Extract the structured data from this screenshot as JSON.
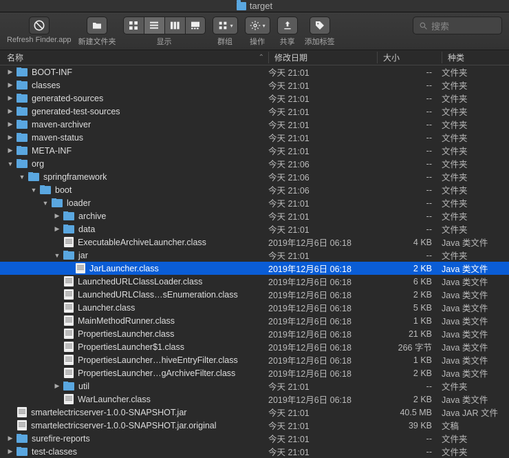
{
  "window": {
    "title": "target"
  },
  "toolbar": {
    "refresh_label": "Refresh Finder.app",
    "new_folder_label": "新建文件夹",
    "view_label": "显示",
    "group_label": "群组",
    "action_label": "操作",
    "share_label": "共享",
    "tags_label": "添加标签",
    "search_placeholder": "搜索"
  },
  "columns": {
    "name": "名称",
    "date": "修改日期",
    "size": "大小",
    "kind": "种类"
  },
  "kinds": {
    "folder": "文件夹",
    "java_class": "Java 类文件",
    "jar": "Java JAR 文件",
    "doc": "文稿"
  },
  "rows": [
    {
      "d": 0,
      "t": "f",
      "e": "c",
      "n": "BOOT-INF",
      "dt": "今天 21:01",
      "s": "--",
      "k": "folder"
    },
    {
      "d": 0,
      "t": "f",
      "e": "c",
      "n": "classes",
      "dt": "今天 21:01",
      "s": "--",
      "k": "folder"
    },
    {
      "d": 0,
      "t": "f",
      "e": "c",
      "n": "generated-sources",
      "dt": "今天 21:01",
      "s": "--",
      "k": "folder"
    },
    {
      "d": 0,
      "t": "f",
      "e": "c",
      "n": "generated-test-sources",
      "dt": "今天 21:01",
      "s": "--",
      "k": "folder"
    },
    {
      "d": 0,
      "t": "f",
      "e": "c",
      "n": "maven-archiver",
      "dt": "今天 21:01",
      "s": "--",
      "k": "folder"
    },
    {
      "d": 0,
      "t": "f",
      "e": "c",
      "n": "maven-status",
      "dt": "今天 21:01",
      "s": "--",
      "k": "folder"
    },
    {
      "d": 0,
      "t": "f",
      "e": "c",
      "n": "META-INF",
      "dt": "今天 21:01",
      "s": "--",
      "k": "folder"
    },
    {
      "d": 0,
      "t": "f",
      "e": "o",
      "n": "org",
      "dt": "今天 21:06",
      "s": "--",
      "k": "folder"
    },
    {
      "d": 1,
      "t": "f",
      "e": "o",
      "n": "springframework",
      "dt": "今天 21:06",
      "s": "--",
      "k": "folder"
    },
    {
      "d": 2,
      "t": "f",
      "e": "o",
      "n": "boot",
      "dt": "今天 21:06",
      "s": "--",
      "k": "folder"
    },
    {
      "d": 3,
      "t": "f",
      "e": "o",
      "n": "loader",
      "dt": "今天 21:01",
      "s": "--",
      "k": "folder"
    },
    {
      "d": 4,
      "t": "f",
      "e": "c",
      "n": "archive",
      "dt": "今天 21:01",
      "s": "--",
      "k": "folder"
    },
    {
      "d": 4,
      "t": "f",
      "e": "c",
      "n": "data",
      "dt": "今天 21:01",
      "s": "--",
      "k": "folder"
    },
    {
      "d": 4,
      "t": "c",
      "n": "ExecutableArchiveLauncher.class",
      "dt": "2019年12月6日 06:18",
      "s": "4 KB",
      "k": "java_class"
    },
    {
      "d": 4,
      "t": "f",
      "e": "o",
      "n": "jar",
      "dt": "今天 21:01",
      "s": "--",
      "k": "folder"
    },
    {
      "d": 5,
      "t": "c",
      "n": "JarLauncher.class",
      "dt": "2019年12月6日 06:18",
      "s": "2 KB",
      "k": "java_class",
      "sel": true
    },
    {
      "d": 4,
      "t": "c",
      "n": "LaunchedURLClassLoader.class",
      "dt": "2019年12月6日 06:18",
      "s": "6 KB",
      "k": "java_class"
    },
    {
      "d": 4,
      "t": "c",
      "n": "LaunchedURLClass…sEnumeration.class",
      "dt": "2019年12月6日 06:18",
      "s": "2 KB",
      "k": "java_class"
    },
    {
      "d": 4,
      "t": "c",
      "n": "Launcher.class",
      "dt": "2019年12月6日 06:18",
      "s": "5 KB",
      "k": "java_class"
    },
    {
      "d": 4,
      "t": "c",
      "n": "MainMethodRunner.class",
      "dt": "2019年12月6日 06:18",
      "s": "1 KB",
      "k": "java_class"
    },
    {
      "d": 4,
      "t": "c",
      "n": "PropertiesLauncher.class",
      "dt": "2019年12月6日 06:18",
      "s": "21 KB",
      "k": "java_class"
    },
    {
      "d": 4,
      "t": "c",
      "n": "PropertiesLauncher$1.class",
      "dt": "2019年12月6日 06:18",
      "s": "266 字节",
      "k": "java_class"
    },
    {
      "d": 4,
      "t": "c",
      "n": "PropertiesLauncher…hiveEntryFilter.class",
      "dt": "2019年12月6日 06:18",
      "s": "1 KB",
      "k": "java_class"
    },
    {
      "d": 4,
      "t": "c",
      "n": "PropertiesLauncher…gArchiveFilter.class",
      "dt": "2019年12月6日 06:18",
      "s": "2 KB",
      "k": "java_class"
    },
    {
      "d": 4,
      "t": "f",
      "e": "c",
      "n": "util",
      "dt": "今天 21:01",
      "s": "--",
      "k": "folder"
    },
    {
      "d": 4,
      "t": "c",
      "n": "WarLauncher.class",
      "dt": "2019年12月6日 06:18",
      "s": "2 KB",
      "k": "java_class"
    },
    {
      "d": 0,
      "t": "j",
      "n": "smartelectricserver-1.0.0-SNAPSHOT.jar",
      "dt": "今天 21:01",
      "s": "40.5 MB",
      "k": "jar"
    },
    {
      "d": 0,
      "t": "d",
      "n": "smartelectricserver-1.0.0-SNAPSHOT.jar.original",
      "dt": "今天 21:01",
      "s": "39 KB",
      "k": "doc"
    },
    {
      "d": 0,
      "t": "f",
      "e": "c",
      "n": "surefire-reports",
      "dt": "今天 21:01",
      "s": "--",
      "k": "folder"
    },
    {
      "d": 0,
      "t": "f",
      "e": "c",
      "n": "test-classes",
      "dt": "今天 21:01",
      "s": "--",
      "k": "folder"
    }
  ]
}
